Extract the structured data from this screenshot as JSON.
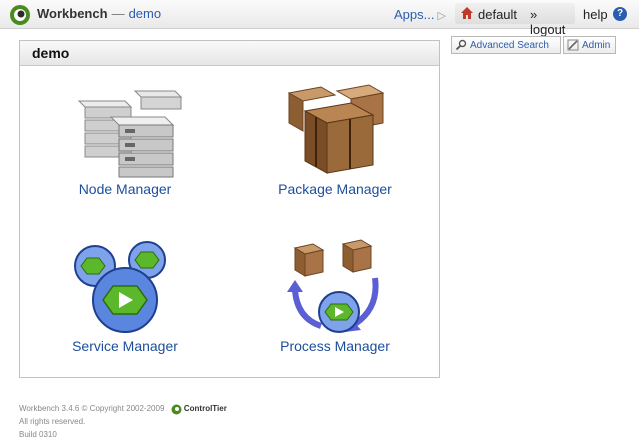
{
  "header": {
    "app_name": "Workbench",
    "separator": "—",
    "project": "demo",
    "apps_label": "Apps...",
    "apps_arrow": "▷",
    "user": "default",
    "logout_label": "» logout",
    "help_label": "help",
    "help_icon": "?"
  },
  "actions": {
    "advanced_search": "Advanced Search",
    "admin": "Admin"
  },
  "panel": {
    "title": "demo",
    "tools": [
      {
        "label": "Node Manager",
        "icon": "server-stack-icon"
      },
      {
        "label": "Package Manager",
        "icon": "package-boxes-icon"
      },
      {
        "label": "Service Manager",
        "icon": "service-cloud-icon"
      },
      {
        "label": "Process Manager",
        "icon": "process-cycle-icon"
      }
    ]
  },
  "footer": {
    "copyright": "Workbench 3.4.6 © Copyright 2002-2009",
    "brand": "ControlTier",
    "rights": "All rights reserved.",
    "build": "Build 0310"
  },
  "colors": {
    "link": "#2a5db0",
    "logo_green": "#4b8a1f",
    "box_brown": "#9b6a3a",
    "service_blue": "#3b6fd6"
  }
}
